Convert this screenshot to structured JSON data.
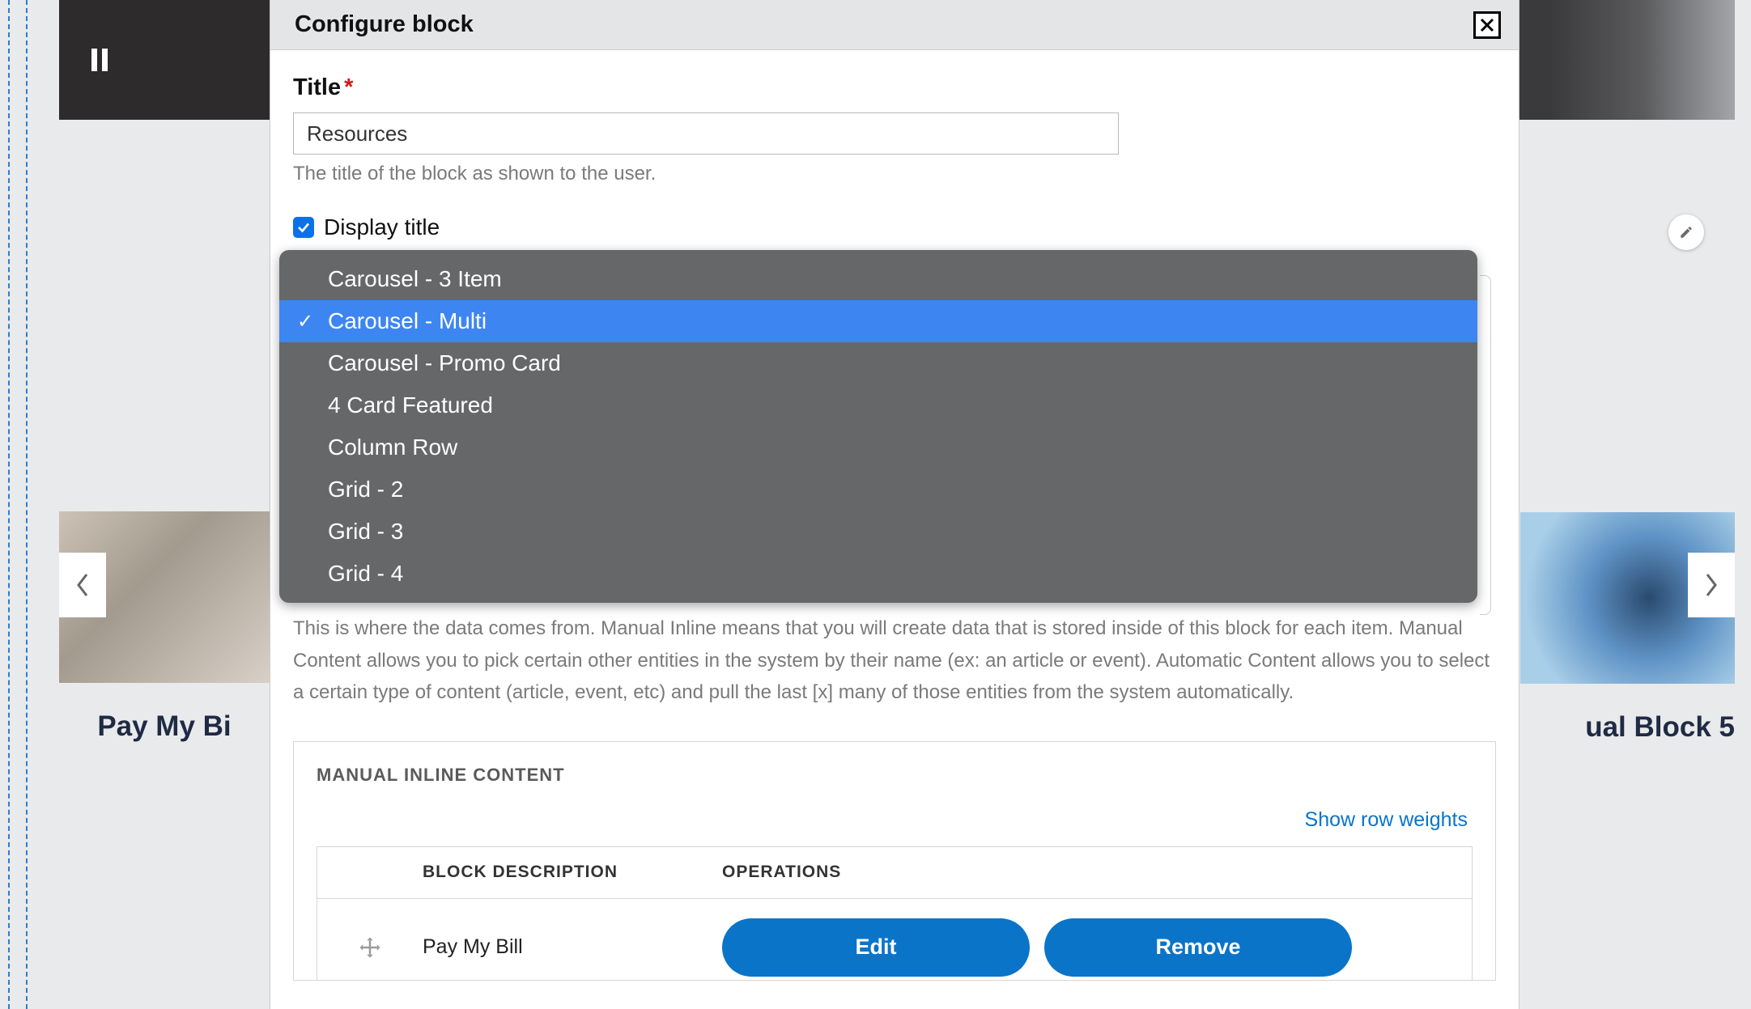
{
  "modal": {
    "header_title": "Configure block",
    "title_label": "Title",
    "title_value": "Resources",
    "title_help": "The title of the block as shown to the user.",
    "display_title_label": "Display title",
    "display_title_checked": true,
    "data_source_help": "This is where the data comes from. Manual Inline means that you will create data that is stored inside of this block for each item. Manual Content allows you to pick certain other entities in the system by their name (ex: an article or event). Automatic Content allows you to select a certain type of content (article, event, etc) and pull the last [x] many of those entities from the system automatically."
  },
  "dropdown": {
    "options": [
      {
        "label": "Carousel - 3 Item",
        "selected": false
      },
      {
        "label": "Carousel - Multi",
        "selected": true
      },
      {
        "label": "Carousel - Promo Card",
        "selected": false
      },
      {
        "label": "4 Card Featured",
        "selected": false
      },
      {
        "label": "Column Row",
        "selected": false
      },
      {
        "label": "Grid - 2",
        "selected": false
      },
      {
        "label": "Grid - 3",
        "selected": false
      },
      {
        "label": "Grid - 4",
        "selected": false
      }
    ]
  },
  "fieldset": {
    "legend": "MANUAL INLINE CONTENT",
    "show_weights": "Show row weights",
    "columns": {
      "desc": "BLOCK DESCRIPTION",
      "ops": "OPERATIONS"
    },
    "rows": [
      {
        "desc": "Pay My Bill",
        "edit": "Edit",
        "remove": "Remove"
      }
    ]
  },
  "background": {
    "card_left_title": "Pay My Bi",
    "card_right_title": "ual Block 5"
  }
}
